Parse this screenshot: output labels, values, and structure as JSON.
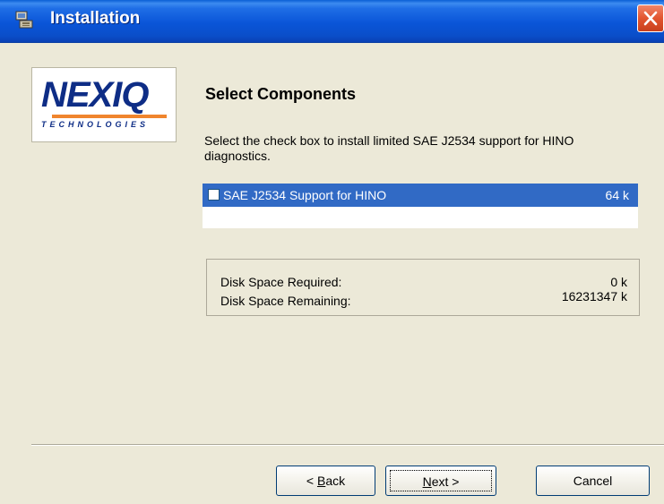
{
  "window": {
    "title": "Installation",
    "icon": "installer-icon",
    "close_icon": "close-icon"
  },
  "logo": {
    "main": "NEXIQ",
    "sub": "TECHNOLOGIES"
  },
  "content": {
    "heading": "Select Components",
    "description": "Select the check box to install limited SAE J2534 support for HINO diagnostics.",
    "components": [
      {
        "label": "SAE J2534 Support for HINO",
        "size": "64 k",
        "checked": false,
        "selected": true
      }
    ],
    "disk": {
      "required_label": "Disk Space Required:",
      "required_value": "0 k",
      "remaining_label": "Disk Space Remaining:",
      "remaining_value": "16231347 k"
    }
  },
  "buttons": {
    "back_prefix": "< ",
    "back_mnemonic": "B",
    "back_rest": "ack",
    "next_mnemonic": "N",
    "next_rest": "ext >",
    "cancel": "Cancel"
  },
  "colors": {
    "titlebar": "#0a55d8",
    "selection": "#316ac5",
    "close": "#e2552f",
    "logo_blue": "#0e2d86",
    "logo_orange": "#f0852d"
  }
}
